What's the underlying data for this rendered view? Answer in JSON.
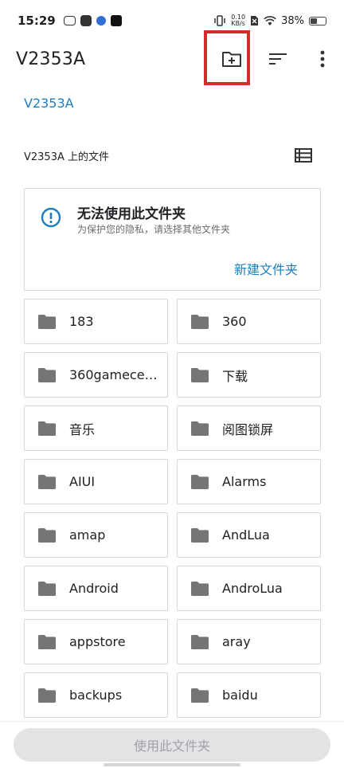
{
  "status_bar": {
    "time": "15:29",
    "net_speed_value": "0.10",
    "net_speed_unit": "KB/s",
    "battery_percent": "38%",
    "battery_level": 0.38
  },
  "app_bar": {
    "title": "V2353A",
    "icons": [
      "new-folder-icon",
      "sort-icon",
      "more-vert-icon"
    ]
  },
  "breadcrumb": {
    "path": "V2353A"
  },
  "files_header": {
    "label": "V2353A 上的文件",
    "view_icon": "list-view-icon"
  },
  "warning": {
    "title": "无法使用此文件夹",
    "subtitle": "为保护您的隐私，请选择其他文件夹",
    "action": "新建文件夹",
    "icon": "info-icon"
  },
  "folders": [
    {
      "name": "183"
    },
    {
      "name": "360"
    },
    {
      "name": "360gamece…"
    },
    {
      "name": "下载"
    },
    {
      "name": "音乐"
    },
    {
      "name": "阅图锁屏"
    },
    {
      "name": "AIUI"
    },
    {
      "name": "Alarms"
    },
    {
      "name": "amap"
    },
    {
      "name": "AndLua"
    },
    {
      "name": "Android"
    },
    {
      "name": "AndroLua"
    },
    {
      "name": "appstore"
    },
    {
      "name": "aray"
    },
    {
      "name": "backups"
    },
    {
      "name": "baidu"
    }
  ],
  "bottom": {
    "use_button": "使用此文件夹"
  },
  "colors": {
    "accent": "#1d7fbf",
    "highlight": "#d42b2b",
    "folder_icon": "#757575",
    "disabled_bg": "#e3e3e6",
    "disabled_text": "#a2a2a6"
  }
}
